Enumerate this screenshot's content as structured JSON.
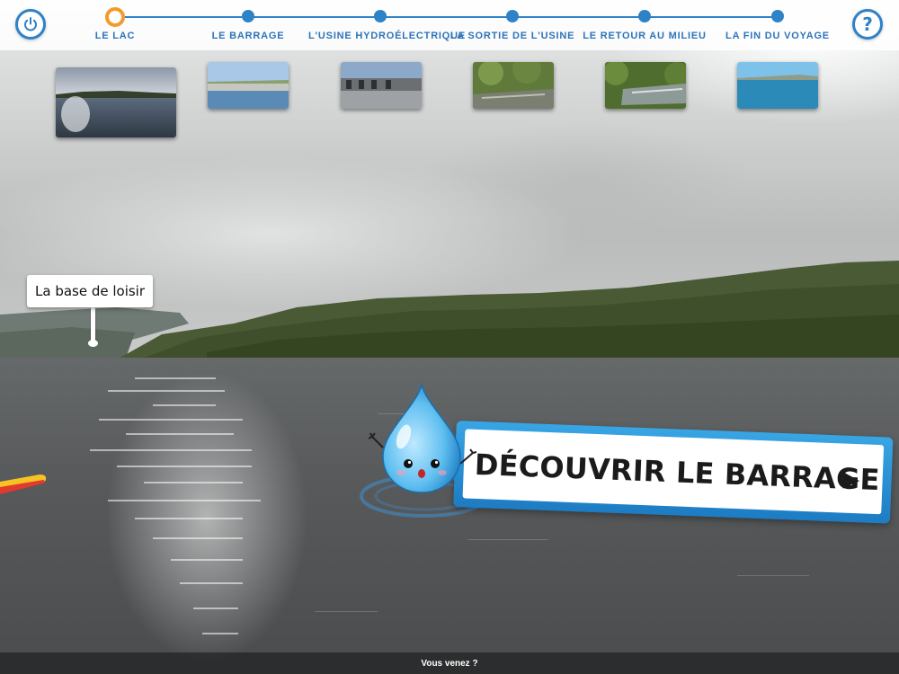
{
  "header": {
    "power_icon": "power-icon",
    "help_icon": "question-mark-icon",
    "help_glyph": "?",
    "accent_color": "#2e82c8",
    "active_color": "#f39a2a",
    "steps": [
      {
        "label": "LE LAC",
        "active": true
      },
      {
        "label": "LE BARRAGE",
        "active": false
      },
      {
        "label": "L'USINE HYDROÉLECTRIQUE",
        "active": false
      },
      {
        "label": "LA SORTIE DE L'USINE",
        "active": false
      },
      {
        "label": "LE RETOUR AU MILIEU",
        "active": false
      },
      {
        "label": "LA FIN DU VOYAGE",
        "active": false
      }
    ]
  },
  "scene": {
    "poi_label": "La base de loisir"
  },
  "cta": {
    "label": "DÉCOUVRIR LE BARRAGE",
    "arrow": "▶",
    "mascot_icon": "water-drop-mascot-icon"
  },
  "footer": {
    "prompt": "Vous venez ?"
  }
}
